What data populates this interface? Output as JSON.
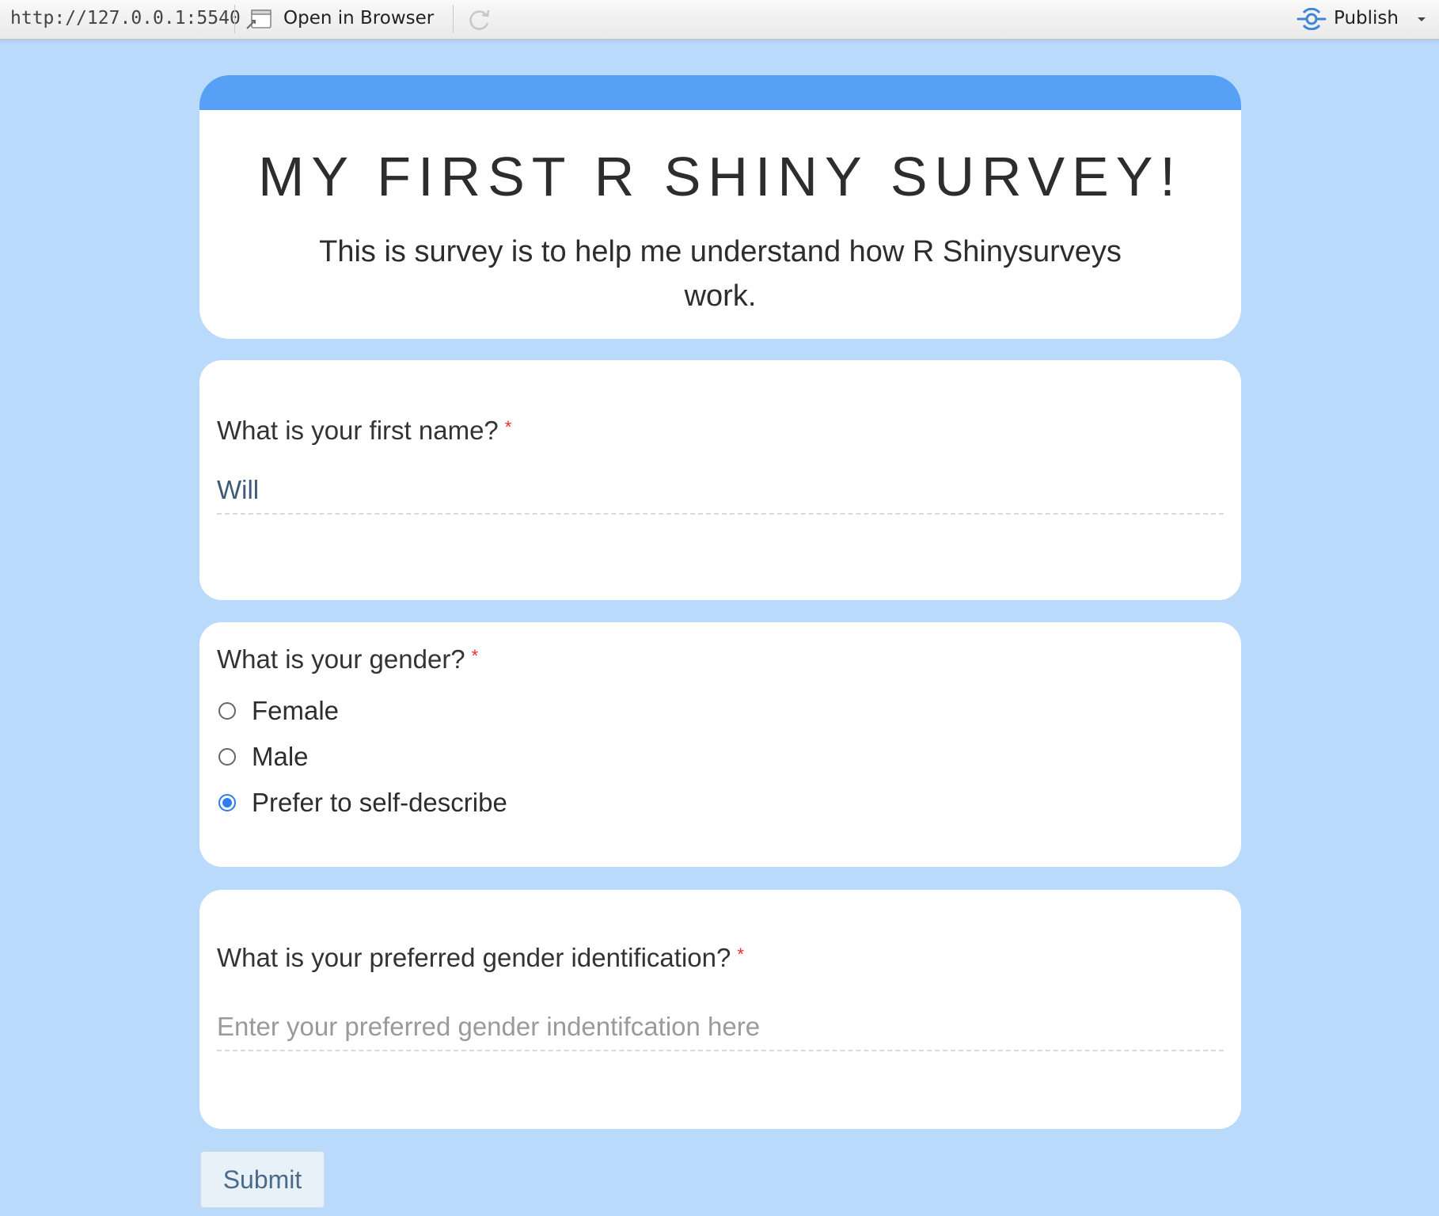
{
  "toolbar": {
    "url": "http://127.0.0.1:5540",
    "open_in_browser_label": "Open in Browser",
    "publish_label": "Publish"
  },
  "colors": {
    "page_background": "#b9dafb",
    "header_band": "#56a0f5",
    "required_marker": "#e0322a",
    "radio_checked": "#2f7bf2"
  },
  "survey": {
    "title": "MY FIRST R SHINY SURVEY!",
    "description": "This is survey is to help me understand how R Shinysurveys work."
  },
  "questions": [
    {
      "label": "What is your first name?",
      "required_mark": "*",
      "type": "text",
      "value": "Will",
      "placeholder": ""
    },
    {
      "label": "What is your gender?",
      "required_mark": "*",
      "type": "radio",
      "options": [
        "Female",
        "Male",
        "Prefer to self-describe"
      ],
      "selected": "Prefer to self-describe"
    },
    {
      "label": "What is your preferred gender identification?",
      "required_mark": "*",
      "type": "text",
      "value": "",
      "placeholder": "Enter your preferred gender indentifcation here"
    }
  ],
  "submit_label": "Submit",
  "icons": {
    "open_in_browser": "open-in-browser-icon",
    "refresh": "refresh-icon",
    "publish": "publish-icon",
    "dropdown": "chevron-down-icon"
  }
}
